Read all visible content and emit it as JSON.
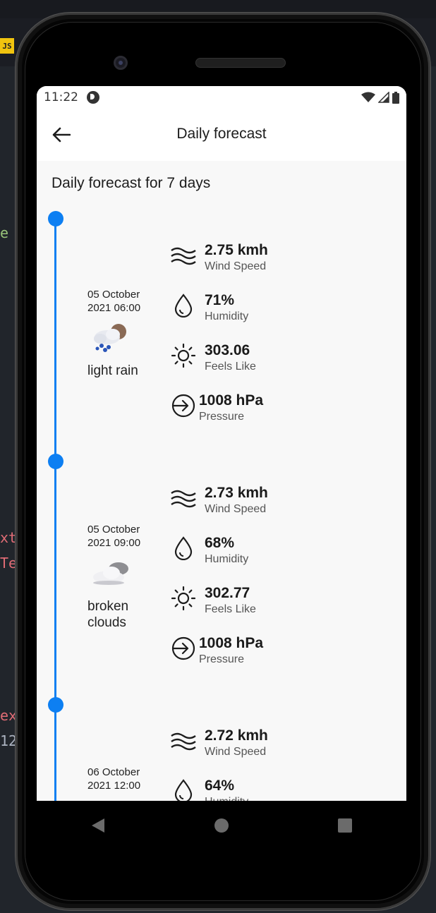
{
  "editor": {
    "badge": "JS",
    "fragments": [
      {
        "text": "e",
        "color": "#98c379"
      },
      {
        "text": "xt",
        "color": "#e06c75"
      },
      {
        "text": "Te",
        "color": "#e06c75"
      },
      {
        "text": "ex",
        "color": "#e06c75"
      },
      {
        "text": "12",
        "color": "#abb2bf"
      }
    ]
  },
  "status_bar": {
    "time": "11:22"
  },
  "app_bar": {
    "title": "Daily forecast",
    "back_icon": "arrow-back-icon"
  },
  "section_title": "Daily forecast for 7 days",
  "colors": {
    "accent": "#0d7ff2",
    "background": "#f8f8f8"
  },
  "entries": [
    {
      "date": "05 October\n2021 06:00",
      "description": "light rain",
      "icon": "rain-cloud-icon",
      "wind_speed": "2.75 kmh",
      "wind_label": "Wind Speed",
      "humidity": "71%",
      "humidity_label": "Humidity",
      "feels_like": "303.06",
      "feels_label": "Feels Like",
      "pressure": "1008 hPa",
      "pressure_label": "Pressure"
    },
    {
      "date": "05 October\n2021 09:00",
      "description": "broken\nclouds",
      "icon": "broken-clouds-icon",
      "wind_speed": "2.73 kmh",
      "wind_label": "Wind Speed",
      "humidity": "68%",
      "humidity_label": "Humidity",
      "feels_like": "302.77",
      "feels_label": "Feels Like",
      "pressure": "1008 hPa",
      "pressure_label": "Pressure"
    },
    {
      "date": "06 October\n2021 12:00",
      "description": "",
      "icon": "",
      "wind_speed": "2.72 kmh",
      "wind_label": "Wind Speed",
      "humidity": "64%",
      "humidity_label": "Humidity",
      "feels_like": "",
      "feels_label": "",
      "pressure": "",
      "pressure_label": ""
    }
  ]
}
